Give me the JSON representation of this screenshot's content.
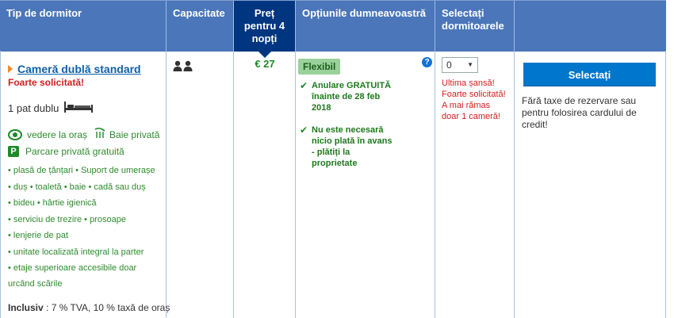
{
  "headers": {
    "room_type": "Tip de dormitor",
    "capacity": "Capacitate",
    "price_line1": "Preț",
    "price_line2": "pentru 4",
    "price_line3": "nopți",
    "options": "Opțiunile dumneavoastră",
    "select_line1": "Selectați",
    "select_line2": "dormitoarele"
  },
  "room": {
    "title": "Cameră dublă standard",
    "sought": "Foarte solicitată!",
    "bed": "1 pat dublu",
    "facilities_icons": [
      {
        "label": "vedere la oraș"
      },
      {
        "label": "Baie privată"
      },
      {
        "label": "Parcare privată gratuită"
      }
    ],
    "amenities": [
      "• plasă de țânțari  • Suport de umerașe",
      "• duș  • toaletă  • baie  • cadă sau duș",
      "• bideu  • hârtie igienică",
      "• serviciu de trezire  • prosoape",
      "• lenjerie de pat",
      "• unitate localizată integral la parter",
      "• etaje superioare accesibile doar",
      "urcând scările"
    ],
    "included_label": "Inclusiv",
    "included_text": " : 7 % TVA, 10 % taxă de oraș"
  },
  "price": "€ 27",
  "options": {
    "badge": "Flexibil",
    "help": "?",
    "items": [
      {
        "lines": [
          "Anulare GRATUITĂ",
          "înainte de 28 feb",
          "2018"
        ]
      },
      {
        "lines": [
          "Nu este necesară",
          "nicio plată în avans",
          "- plătiți la",
          "proprietate"
        ]
      }
    ]
  },
  "selector": {
    "value": "0",
    "caret": "▼",
    "warning_lines": [
      "Ultima șansă!",
      "Foarte solicitată!",
      "A mai rămas",
      "doar 1 cameră!"
    ]
  },
  "action": {
    "button": "Selectați",
    "fee_note": "Fără taxe de rezervare sau pentru folosirea cardului de credit!"
  },
  "colors": {
    "header_bg": "#4b76b9",
    "price_header_bg": "#003580",
    "button_bg": "#0077cc",
    "green": "#1d8a2a",
    "red": "#d31f1f"
  }
}
